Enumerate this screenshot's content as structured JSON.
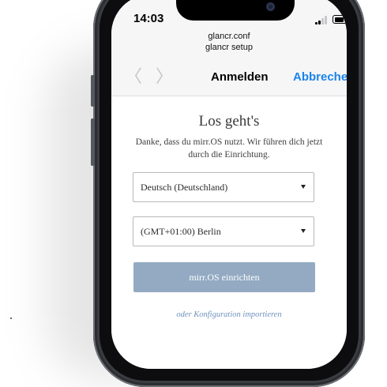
{
  "status_bar": {
    "time": "14:03"
  },
  "browser": {
    "url_line1": "glancr.conf",
    "url_line2": "glancr setup",
    "back_glyph": "〈",
    "forward_glyph": "〉",
    "title": "Anmelden",
    "cancel_label": "Abbrechen",
    "accent_color": "#1a83ec"
  },
  "setup": {
    "heading": "Los geht's",
    "subtext": "Danke, dass du mirr.OS nutzt. Wir führen dich jetzt durch die Einrichtung.",
    "language_select": {
      "value": "Deutsch (Deutschland)"
    },
    "timezone_select": {
      "value": "(GMT+01:00) Berlin"
    },
    "primary_button": {
      "label": "mirr.OS einrichten",
      "color": "#93aac2"
    },
    "import_link": "oder Konfiguration importieren"
  },
  "icons": {
    "signal": "signal-icon",
    "battery": "battery-icon",
    "dropdown": "caret-down-icon"
  }
}
